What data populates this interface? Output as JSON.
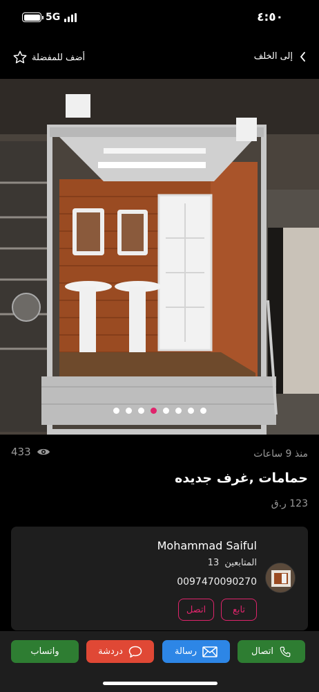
{
  "status": {
    "time": "٤:٥٠",
    "network": "5G"
  },
  "nav": {
    "back_label": "إلى الخلف",
    "favorite_label": "أضف للمفضلة"
  },
  "gallery": {
    "image_count": 8,
    "active_index": 3
  },
  "listing": {
    "time_ago": "منذ 9 ساعات",
    "views": "433",
    "title": "حمامات ,غرف جديده",
    "price": "123 ر.ق"
  },
  "seller": {
    "name": "Mohammad Saiful",
    "followers_label": "المتابعين",
    "followers_count": "13",
    "phone": "0097470090270",
    "follow_label": "تابع",
    "call_label": "اتصل"
  },
  "actions": {
    "call": "اتصال",
    "message": "رسالة",
    "chat": "دردشة",
    "whatsapp": "واتساب"
  },
  "colors": {
    "accent": "#e0246c",
    "call_green": "#2e7d32",
    "message_blue": "#2d86e6",
    "chat_red": "#e04835",
    "card_bg": "#1e1e1e"
  }
}
